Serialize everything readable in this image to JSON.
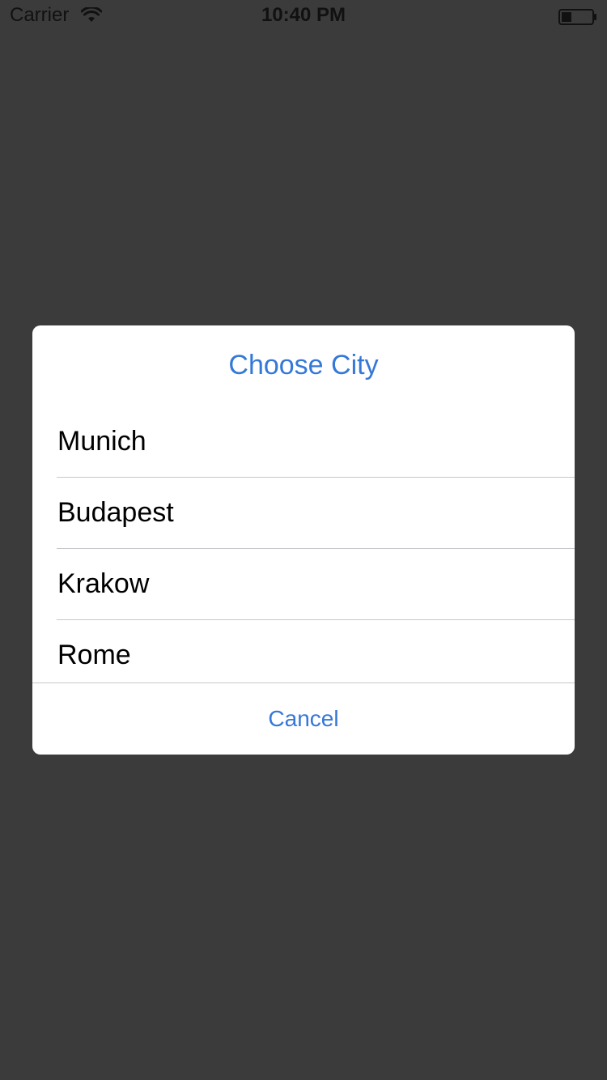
{
  "status_bar": {
    "carrier": "Carrier",
    "time": "10:40 PM",
    "wifi_icon": "wifi-icon",
    "battery_icon": "battery-icon"
  },
  "alert": {
    "title": "Choose City",
    "options": [
      {
        "label": "Munich"
      },
      {
        "label": "Budapest"
      },
      {
        "label": "Krakow"
      },
      {
        "label": "Rome"
      }
    ],
    "cancel_label": "Cancel"
  },
  "colors": {
    "accent": "#3478d8",
    "background_dim": "#3b3b3b",
    "sheet": "#ffffff",
    "separator": "#c8c8cc"
  }
}
